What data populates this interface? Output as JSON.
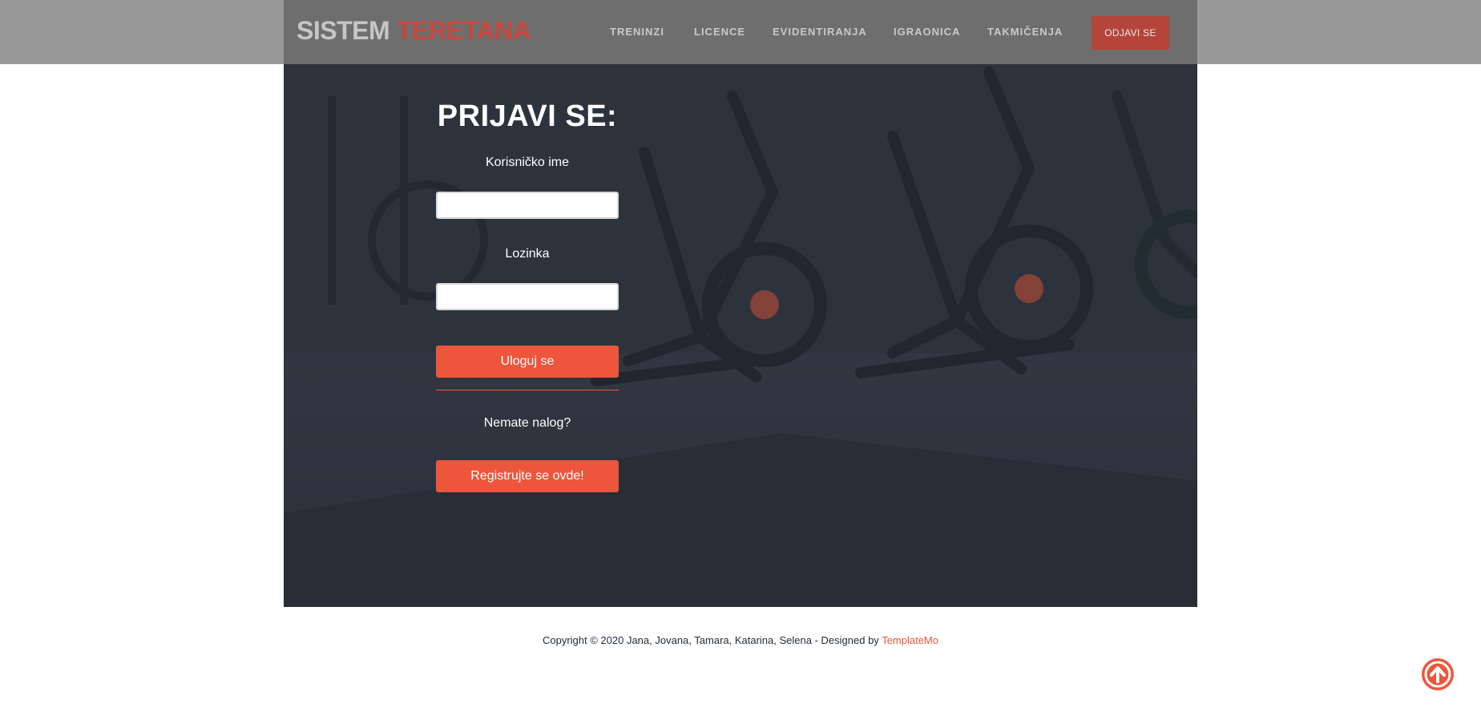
{
  "header": {
    "logo_part1": "SISTEM",
    "logo_part2": "TERETANA",
    "nav": [
      "TRENINZI",
      "LICENCE",
      "EVIDENTIRANJA",
      "IGRAONICA",
      "TAKMIČENJA"
    ],
    "logout_label": "ODJAVI SE"
  },
  "login": {
    "title": "PRIJAVI SE:",
    "username_label": "Korisničko ime",
    "username_value": "",
    "password_label": "Lozinka",
    "password_value": "",
    "submit_label": "Uloguj se",
    "no_account_text": "Nemate nalog?",
    "register_label": "Registrujte se ovde!"
  },
  "footer": {
    "text": "Copyright © 2020 Jana, Jovana, Tamara, Katarina, Selena - Designed by",
    "link": "TemplateMo"
  },
  "icons": {
    "scroll_top": "arrow-up-circle-icon"
  },
  "colors": {
    "accent": "#ed563b",
    "header_bg": "#999999",
    "hero_bg": "#2c313b"
  }
}
